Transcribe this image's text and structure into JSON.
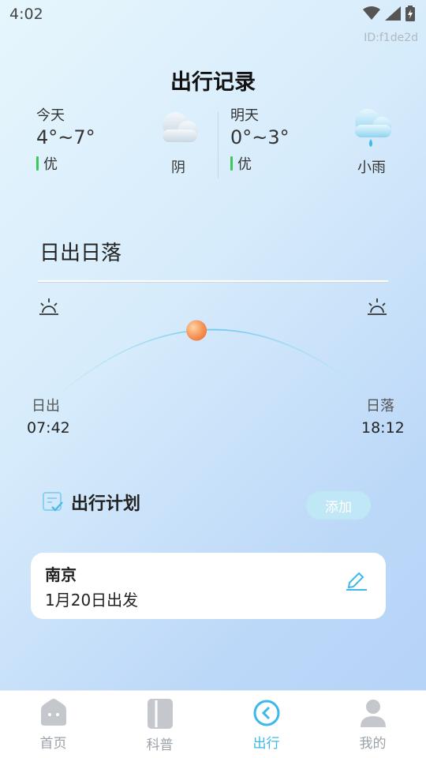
{
  "status": {
    "time": "4:02"
  },
  "app_id": "ID:f1de2d",
  "title": "出行记录",
  "weather": {
    "today": {
      "label": "今天",
      "temp": "4°~7°",
      "aqi": "优",
      "condition": "阴"
    },
    "tomorrow": {
      "label": "明天",
      "temp": "0°~3°",
      "aqi": "优",
      "condition": "小雨"
    }
  },
  "sun": {
    "section_title": "日出日落",
    "sunrise_label": "日出",
    "sunrise_time": "07:42",
    "sunset_label": "日落",
    "sunset_time": "18:12",
    "progress": 0.45
  },
  "plan": {
    "title": "出行计划",
    "add_label": "添加",
    "trips": [
      {
        "city": "南京",
        "date": "1月20日出发"
      }
    ]
  },
  "tabs": [
    {
      "label": "首页",
      "icon": "home-icon"
    },
    {
      "label": "科普",
      "icon": "book-icon"
    },
    {
      "label": "出行",
      "icon": "travel-icon"
    },
    {
      "label": "我的",
      "icon": "profile-icon"
    }
  ],
  "colors": {
    "accent": "#2bb5e8",
    "aqi_good": "#3bc75a",
    "sun": "#f79b5e"
  }
}
